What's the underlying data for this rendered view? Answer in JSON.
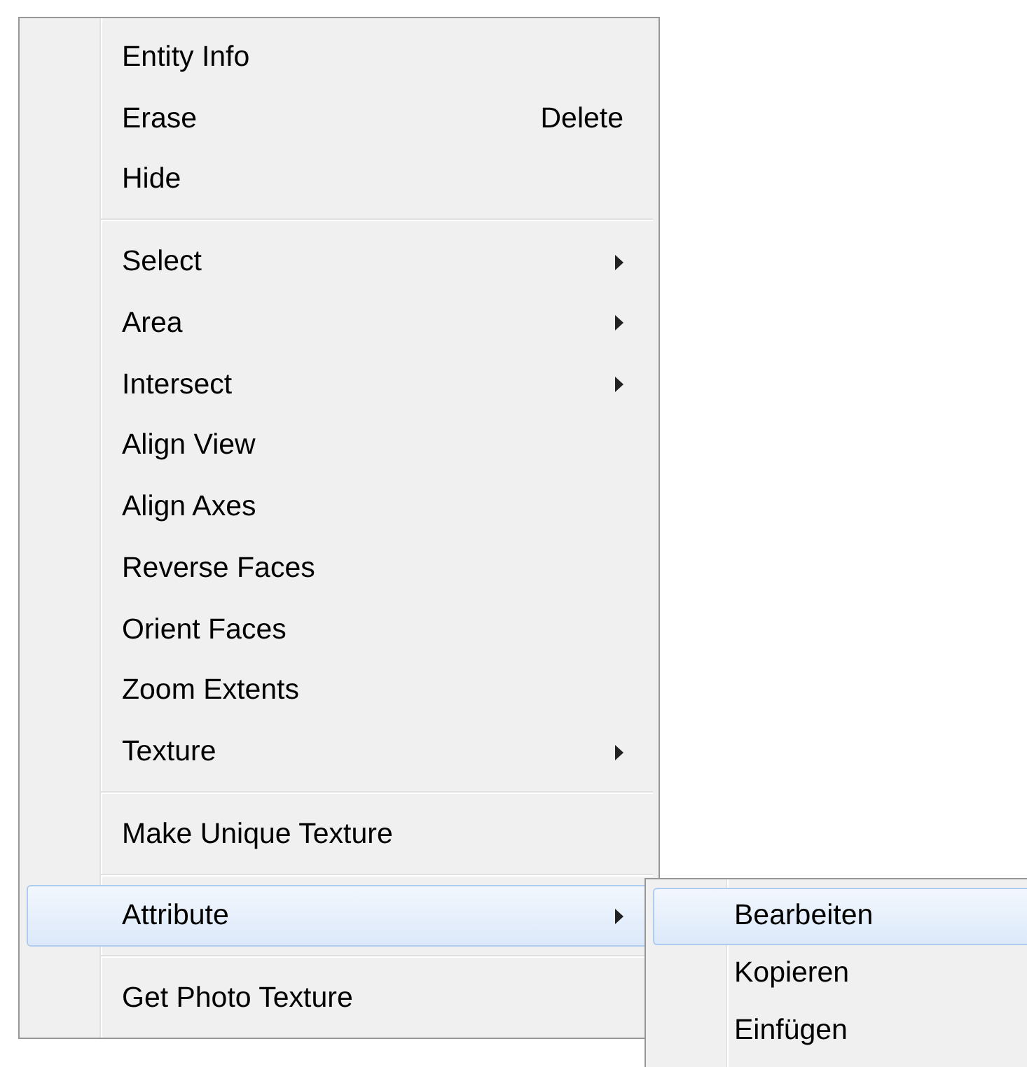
{
  "menu": {
    "items": [
      {
        "kind": "item",
        "label": "Entity Info",
        "submenu": false,
        "selected": false
      },
      {
        "kind": "item",
        "label": "Erase",
        "shortcut": "Delete",
        "submenu": false,
        "selected": false
      },
      {
        "kind": "item",
        "label": "Hide",
        "submenu": false,
        "selected": false
      },
      {
        "kind": "separator"
      },
      {
        "kind": "item",
        "label": "Select",
        "submenu": true,
        "selected": false
      },
      {
        "kind": "item",
        "label": "Area",
        "submenu": true,
        "selected": false
      },
      {
        "kind": "item",
        "label": "Intersect",
        "submenu": true,
        "selected": false
      },
      {
        "kind": "item",
        "label": "Align View",
        "submenu": false,
        "selected": false
      },
      {
        "kind": "item",
        "label": "Align Axes",
        "submenu": false,
        "selected": false
      },
      {
        "kind": "item",
        "label": "Reverse Faces",
        "submenu": false,
        "selected": false
      },
      {
        "kind": "item",
        "label": "Orient Faces",
        "submenu": false,
        "selected": false
      },
      {
        "kind": "item",
        "label": "Zoom Extents",
        "submenu": false,
        "selected": false
      },
      {
        "kind": "item",
        "label": "Texture",
        "submenu": true,
        "selected": false
      },
      {
        "kind": "separator"
      },
      {
        "kind": "item",
        "label": "Make Unique Texture",
        "submenu": false,
        "selected": false
      },
      {
        "kind": "separator"
      },
      {
        "kind": "item",
        "label": "Attribute",
        "submenu": true,
        "selected": true
      },
      {
        "kind": "separator"
      },
      {
        "kind": "item",
        "label": "Get Photo Texture",
        "submenu": false,
        "selected": false
      }
    ]
  },
  "submenu": {
    "items": [
      {
        "kind": "item",
        "label": "Bearbeiten",
        "selected": true
      },
      {
        "kind": "item",
        "label": "Kopieren",
        "selected": false
      },
      {
        "kind": "item",
        "label": "Einfügen",
        "selected": false
      }
    ]
  }
}
